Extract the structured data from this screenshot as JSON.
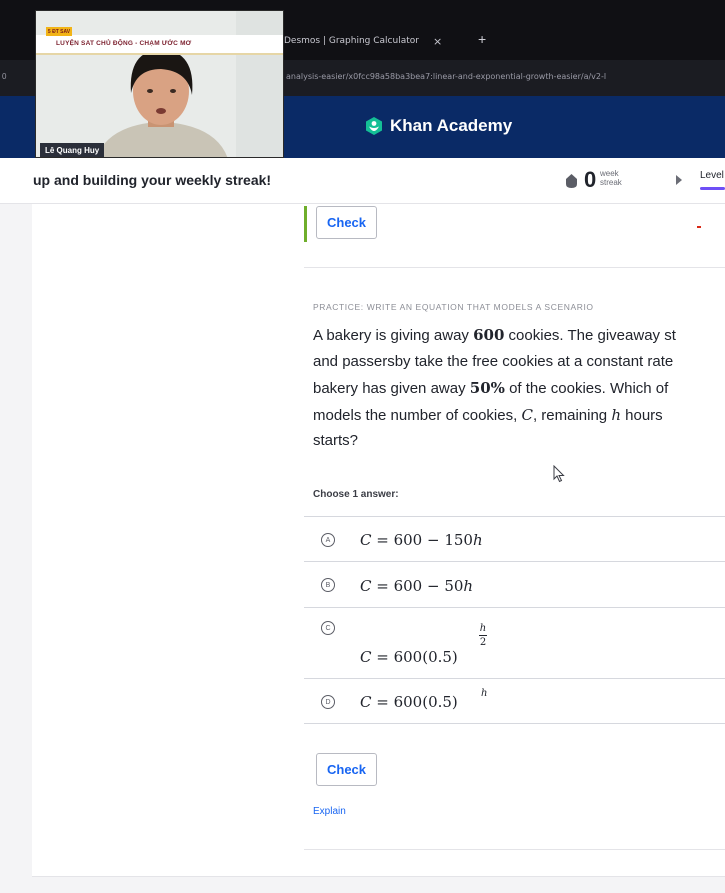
{
  "browser": {
    "left_edge": "0",
    "tab_title": "Desmos | Graphing Calculator",
    "tab_close": "×",
    "new_tab": "+",
    "url": "analysis-easier/x0fcc98a58ba3bea7:linear-and-exponential-growth-easier/a/v2-l"
  },
  "header": {
    "logo_text": "Khan Academy"
  },
  "streak": {
    "message": "up and building your weekly streak!",
    "count": "0",
    "unit_line1": "week",
    "unit_line2": "streak",
    "level_label": "Level"
  },
  "previous": {
    "check_label": "Check"
  },
  "question": {
    "practice_label": "PRACTICE: WRITE AN EQUATION THAT MODELS A SCENARIO",
    "line1_a": "A bakery is giving away ",
    "line1_num": "600",
    "line1_b": " cookies. The giveaway st",
    "line2": "and passersby take the free cookies at a constant rate",
    "line3_a": "bakery has given away ",
    "line3_num": "50%",
    "line3_b": " of the cookies. Which of",
    "line4_a": "models the number of cookies, ",
    "line4_var": "C",
    "line4_b": ", remaining ",
    "line4_var2": "h",
    "line4_c": " hours",
    "line5": "starts?",
    "choose_label": "Choose 1 answer:"
  },
  "choices": [
    {
      "letter": "A",
      "lhs": "C",
      "eq": " = 600 − 150",
      "var": "h"
    },
    {
      "letter": "B",
      "lhs": "C",
      "eq": " = 600 − 50",
      "var": "h"
    },
    {
      "letter": "C",
      "lhs": "C",
      "eq": " = 600(0.5)",
      "exp_num": "h",
      "exp_den": "2"
    },
    {
      "letter": "D",
      "lhs": "C",
      "eq": " = 600(0.5)",
      "exp": "h"
    }
  ],
  "actions": {
    "check_label": "Check",
    "explain_label": "Explain"
  },
  "webcam": {
    "badge": "5 ĐT SAV",
    "banner_title": "LUYỆN SAT CHỦ ĐỘNG - CHẠM ƯỚC MƠ",
    "presenter_name": "Lê Quang Huy"
  },
  "colors": {
    "ka_navy": "#0a2a66",
    "ka_link_blue": "#1865f2",
    "ka_green": "#14bf96",
    "level_purple": "#6e4ff6"
  }
}
